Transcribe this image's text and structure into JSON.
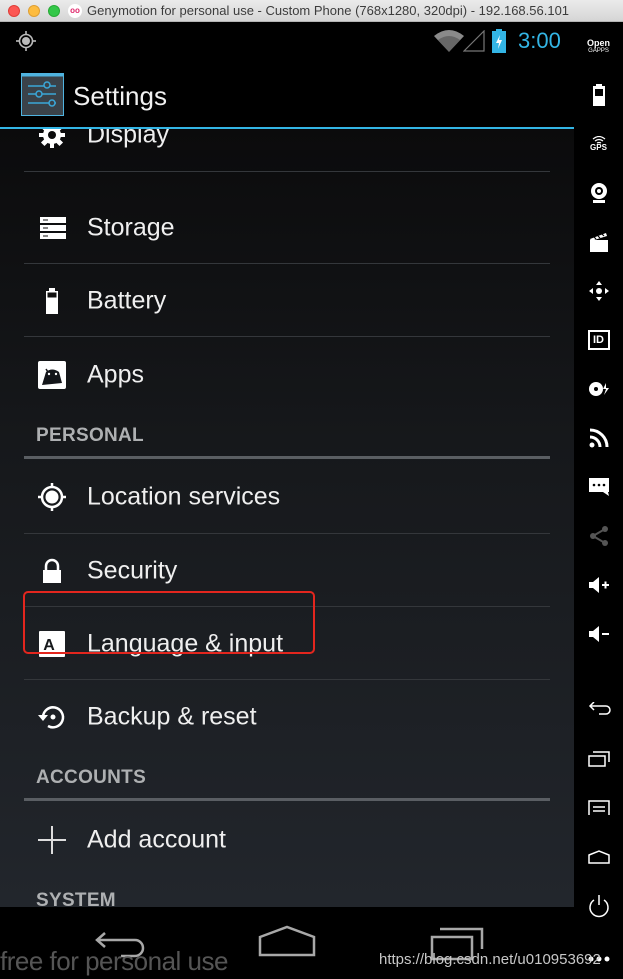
{
  "window": {
    "title": "Genymotion for personal use - Custom Phone (768x1280, 320dpi) - 192.168.56.101",
    "logo_glyph": "oo"
  },
  "statusbar": {
    "time": "3:00",
    "icons": [
      "location-icon",
      "wifi-icon",
      "signal-icon",
      "battery-charging-icon"
    ],
    "accent_color": "#33b5e5"
  },
  "actionbar": {
    "title": "Settings"
  },
  "settings": {
    "items_top": [
      {
        "label": "Display",
        "icon": "display-gear-icon"
      },
      {
        "label": "Storage",
        "icon": "storage-icon"
      },
      {
        "label": "Battery",
        "icon": "battery-icon"
      },
      {
        "label": "Apps",
        "icon": "apps-icon"
      }
    ],
    "sections": {
      "personal": "PERSONAL",
      "accounts": "ACCOUNTS",
      "system": "SYSTEM"
    },
    "items_personal": [
      {
        "label": "Location services",
        "icon": "location-icon"
      },
      {
        "label": "Security",
        "icon": "lock-icon"
      },
      {
        "label": "Language & input",
        "icon": "language-icon",
        "highlighted": true
      },
      {
        "label": "Backup & reset",
        "icon": "backup-icon"
      }
    ],
    "items_accounts": [
      {
        "label": "Add account",
        "icon": "plus-icon"
      }
    ],
    "highlight_color": "#e3261e"
  },
  "navbar": {
    "buttons": [
      "back",
      "home",
      "recent-apps"
    ]
  },
  "sidetoolbar": {
    "open_gapps": {
      "line1": "Open",
      "line2": "GAPPS"
    },
    "gps_label": "GPS",
    "id_label": "ID",
    "buttons": [
      "open-gapps",
      "battery",
      "gps",
      "camera",
      "media-capture",
      "remote-control",
      "device-id",
      "disk-io",
      "network",
      "sms",
      "share",
      "volume-up",
      "volume-down",
      "back",
      "recent-apps",
      "menu",
      "home",
      "power",
      "more"
    ]
  },
  "overlay": {
    "watermark": "free for personal use",
    "source_url": "https://blog.csdn.net/u010953692"
  }
}
